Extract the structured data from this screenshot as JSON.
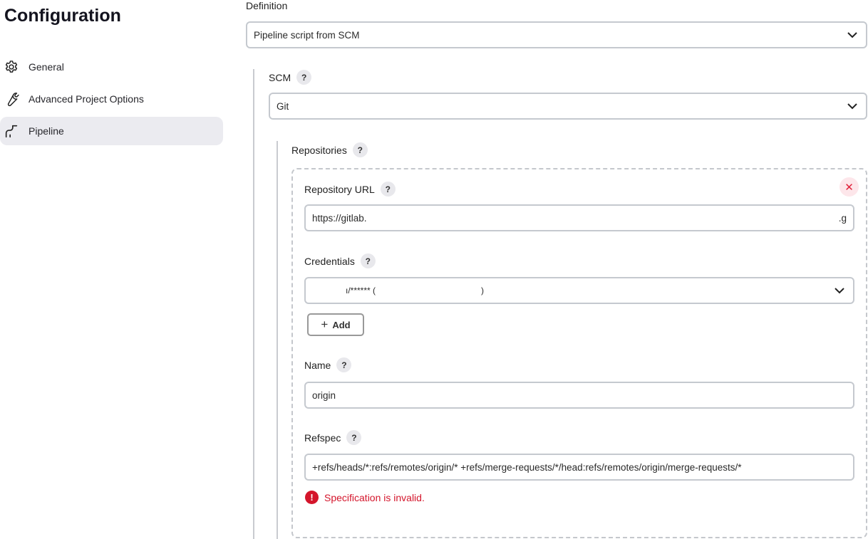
{
  "page": {
    "title": "Configuration"
  },
  "sidebar": {
    "items": [
      {
        "label": "General",
        "icon": "gear-icon"
      },
      {
        "label": "Advanced Project Options",
        "icon": "wrench-icon"
      },
      {
        "label": "Pipeline",
        "icon": "pipeline-icon",
        "active": true
      }
    ]
  },
  "definition": {
    "label": "Definition",
    "value": "Pipeline script from SCM"
  },
  "scm": {
    "label": "SCM",
    "value": "Git"
  },
  "repositories": {
    "label": "Repositories",
    "repository_url": {
      "label": "Repository URL",
      "value_start": "https://gitlab.",
      "value_end": ".g"
    },
    "credentials": {
      "label": "Credentials",
      "value_part1": "ı/****** (",
      "value_part2": ")",
      "add_label": "Add"
    },
    "name": {
      "label": "Name",
      "value": "origin"
    },
    "refspec": {
      "label": "Refspec",
      "value": "+refs/heads/*:refs/remotes/origin/* +refs/merge-requests/*/head:refs/remotes/origin/merge-requests/*",
      "error": "Specification is invalid."
    }
  },
  "help_glyph": "?",
  "colors": {
    "error": "#d4152b",
    "active_nav_bg": "#ebebf0",
    "border": "#c5c9cf"
  }
}
